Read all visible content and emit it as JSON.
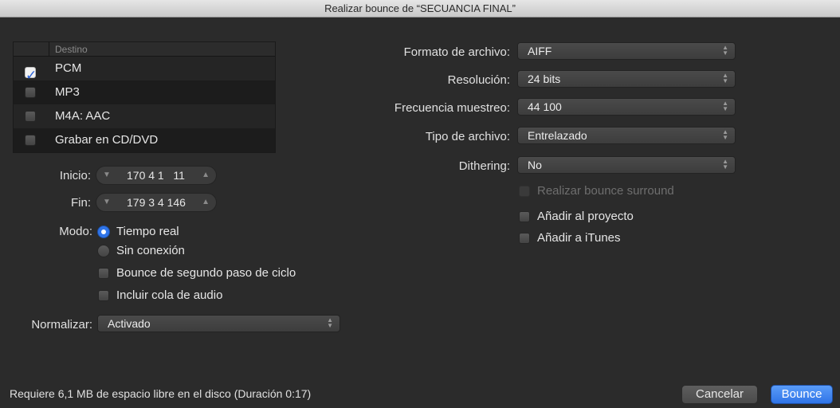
{
  "window": {
    "title": "Realizar bounce de “SECUANCIA FINAL”"
  },
  "destination": {
    "header": "Destino",
    "items": [
      {
        "label": "PCM",
        "checked": true
      },
      {
        "label": "MP3",
        "checked": false
      },
      {
        "label": "M4A: AAC",
        "checked": false
      },
      {
        "label": "Grabar en CD/DVD",
        "checked": false
      }
    ]
  },
  "range": {
    "start_label": "Inicio:",
    "start_value": "170 4 1   11",
    "end_label": "Fin:",
    "end_value": "179 3 4 146"
  },
  "mode": {
    "label": "Modo:",
    "options": [
      {
        "label": "Tiempo real",
        "selected": true
      },
      {
        "label": "Sin conexión",
        "selected": false
      }
    ],
    "checkboxes": [
      {
        "label": "Bounce de segundo paso de ciclo",
        "checked": false
      },
      {
        "label": "Incluir cola de audio",
        "checked": false
      }
    ]
  },
  "normalize": {
    "label": "Normalizar:",
    "value": "Activado"
  },
  "format": {
    "file_format_label": "Formato de archivo:",
    "file_format_value": "AIFF",
    "resolution_label": "Resolución:",
    "resolution_value": "24 bits",
    "sample_rate_label": "Frecuencia muestreo:",
    "sample_rate_value": "44 100",
    "file_type_label": "Tipo de archivo:",
    "file_type_value": "Entrelazado",
    "dithering_label": "Dithering:",
    "dithering_value": "No"
  },
  "options": {
    "surround": {
      "label": "Realizar bounce surround",
      "enabled": false
    },
    "add_project": {
      "label": "Añadir al proyecto",
      "checked": false
    },
    "add_itunes": {
      "label": "Añadir a iTunes",
      "checked": false
    }
  },
  "footer": {
    "info": "Requiere 6,1 MB de espacio libre en el disco (Duración 0:17)",
    "cancel_label": "Cancelar",
    "bounce_label": "Bounce"
  },
  "colors": {
    "accent": "#2f74e8",
    "background": "#2b2b2b"
  }
}
